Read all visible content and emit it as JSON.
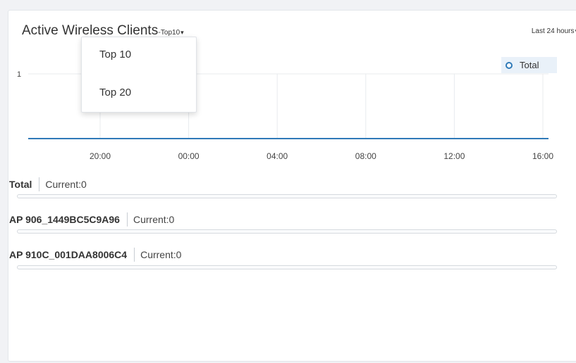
{
  "widget": {
    "title": "Active Wireless Clients",
    "title_sep": "-",
    "topn_selected": "Top10",
    "caret": "▾",
    "time_range": "Last 24 hours"
  },
  "dropdown": {
    "options": [
      "Top 10",
      "Top 20"
    ]
  },
  "chart_data": {
    "type": "line",
    "x_ticks": [
      "20:00",
      "00:00",
      "04:00",
      "08:00",
      "12:00",
      "16:00"
    ],
    "y_ticks": [
      "1"
    ],
    "ylim": [
      0,
      1
    ],
    "legend": [
      "Total"
    ],
    "legend_position": "top-right",
    "series": [
      {
        "name": "Total",
        "color": "#2f7ab8",
        "values": [
          0,
          0,
          0,
          0,
          0,
          0
        ]
      }
    ]
  },
  "stats": [
    {
      "name": "Total",
      "current": "Current:0",
      "fill": 0
    },
    {
      "name": "AP 906_1449BC5C9A96",
      "current": "Current:0",
      "fill": 0
    },
    {
      "name": "AP 910C_001DAA8006C4",
      "current": "Current:0",
      "fill": 0
    }
  ],
  "colors": {
    "accent": "#2f7ab8",
    "grid": "#e8ebee"
  }
}
